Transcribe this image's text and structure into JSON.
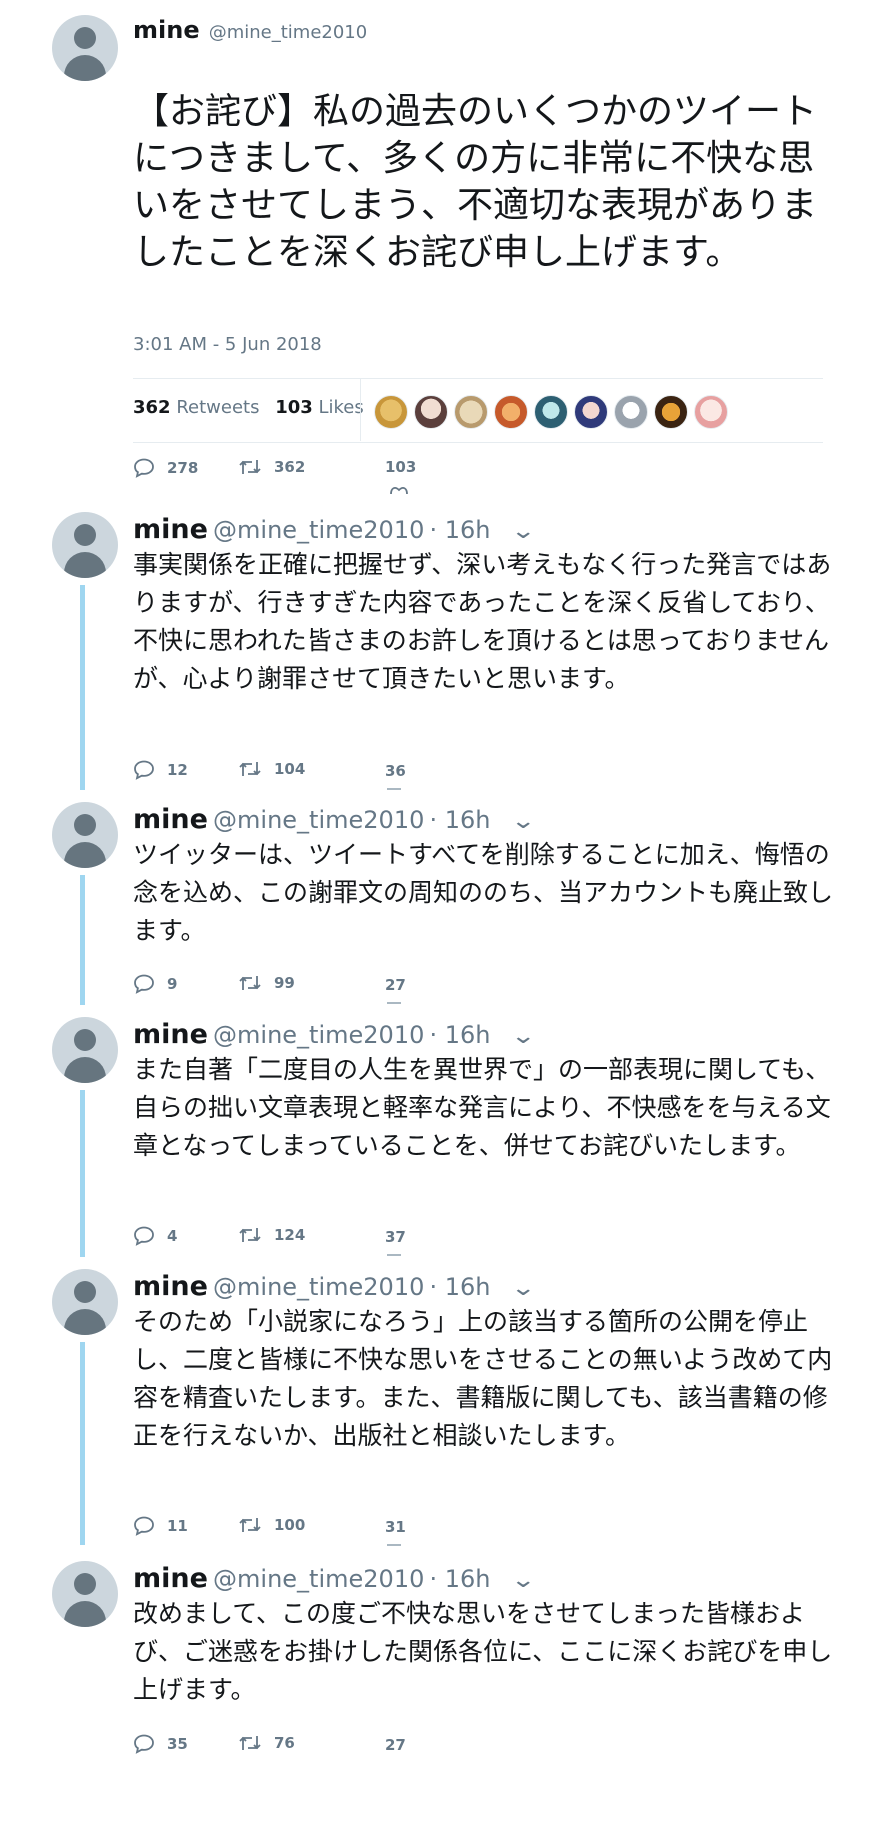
{
  "main_tweet": {
    "name": "mine",
    "handle": "@mine_time2010",
    "text": "【お詫び】私の過去のいくつかのツイートにつきまして、多くの方に非常に不快な思いをさせてしまう、不適切な表現がありましたことを深くお詫び申し上げます。",
    "timestamp": "3:01 AM - 5 Jun 2018",
    "retweets_count": "362",
    "retweets_label": "Retweets",
    "likes_count": "103",
    "likes_label": "Likes",
    "replies": "278",
    "retweets": "362",
    "likes": "103"
  },
  "replies": [
    {
      "name": "mine",
      "handle": "@mine_time2010",
      "time": "· 16h",
      "text": "事実関係を正確に把握せず、深い考えもなく行った発言ではありますが、行きすぎた内容であったことを深く反省しており、不快に思われた皆さまのお許しを頂けるとは思っておりませんが、心より謝罪させて頂きたいと思います。",
      "replies": "12",
      "retweets": "104",
      "likes": "36"
    },
    {
      "name": "mine",
      "handle": "@mine_time2010",
      "time": "· 16h",
      "text": "ツイッターは、ツイートすべてを削除することに加え、悔悟の念を込め、この謝罪文の周知ののち、当アカウントも廃止致します。",
      "replies": "9",
      "retweets": "99",
      "likes": "27"
    },
    {
      "name": "mine",
      "handle": "@mine_time2010",
      "time": "· 16h",
      "text": "また自著「二度目の人生を異世界で」の一部表現に関しても、自らの拙い文章表現と軽率な発言により、不快感をを与える文章となってしまっていることを、併せてお詫びいたします。",
      "replies": "4",
      "retweets": "124",
      "likes": "37"
    },
    {
      "name": "mine",
      "handle": "@mine_time2010",
      "time": "· 16h",
      "text": "そのため「小説家になろう」上の該当する箇所の公開を停止し、二度と皆様に不快な思いをさせることの無いよう改めて内容を精査いたします。また、書籍版に関しても、該当書籍の修正を行えないか、出版社と相談いたします。",
      "replies": "11",
      "retweets": "100",
      "likes": "31"
    },
    {
      "name": "mine",
      "handle": "@mine_time2010",
      "time": "· 16h",
      "text": "改めまして、この度ご不快な思いをさせてしまった皆様および、ご迷惑をお掛けした関係各位に、ここに深くお詫びを申し上げます。",
      "replies": "35",
      "retweets": "76",
      "likes": "27"
    }
  ],
  "icons": {
    "reply": "reply-icon",
    "retweet": "retweet-icon",
    "like": "heart-icon",
    "more": "chevron-down-icon"
  },
  "colors": {
    "thread_line": "#9fd6f0",
    "secondary_text": "#657786",
    "avatar_bg": "#ccd6dd"
  }
}
